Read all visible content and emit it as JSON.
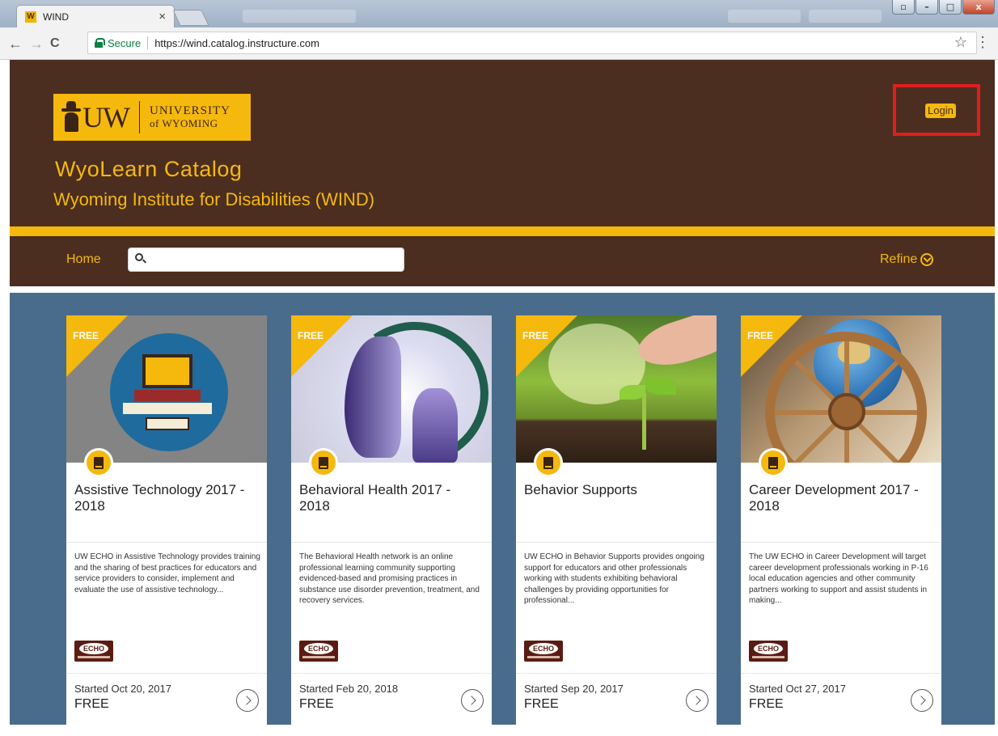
{
  "browser": {
    "tab_title": "WIND",
    "tab_favicon_label": "W",
    "tab_close": "×",
    "secure_label": "Secure",
    "url": "https://wind.catalog.instructure.com",
    "back": "←",
    "forward": "→",
    "reload": "C",
    "star": "☆",
    "menu": "⋮",
    "window_controls": [
      "▫",
      "–",
      "□",
      "x"
    ]
  },
  "header": {
    "logo_mark": "UW",
    "logo_line1": "UNIVERSITY",
    "logo_line2": "of WYOMING",
    "title": "WyoLearn Catalog",
    "subtitle": "Wyoming Institute for Disabilities (WIND)",
    "login_label": "Login"
  },
  "nav": {
    "home_label": "Home",
    "search_value": "",
    "refine_label": "Refine"
  },
  "colors": {
    "brown": "#4b2e20",
    "gold": "#f5b80d",
    "catalog_bg": "#4a6c8c",
    "highlight": "#e01e1e"
  },
  "courses": [
    {
      "ribbon": "FREE",
      "title": "Assistive Technology 2017 - 2018",
      "description": "UW ECHO in Assistive Technology provides training and the sharing of best practices for educators and service providers to consider, implement and evaluate the use of assistive technology...",
      "logo_text": "ECHO",
      "started": "Started Oct 20, 2017",
      "price": "FREE"
    },
    {
      "ribbon": "FREE",
      "title": "Behavioral Health 2017 - 2018",
      "description": "The Behavioral Health network is an online professional learning community supporting evidenced-based and promising practices in substance use disorder prevention, treatment, and recovery services.",
      "logo_text": "ECHO",
      "started": "Started Feb 20, 2018",
      "price": "FREE"
    },
    {
      "ribbon": "FREE",
      "title": "Behavior Supports",
      "description": "UW ECHO in Behavior Supports provides ongoing support for educators and other professionals working with students exhibiting behavioral challenges by providing opportunities for professional...",
      "logo_text": "ECHO",
      "started": "Started Sep 20, 2017",
      "price": "FREE"
    },
    {
      "ribbon": "FREE",
      "title": "Career Development 2017 - 2018",
      "description": "The UW ECHO in Career Development will target career development professionals working in P-16 local education agencies and other community partners working to support and assist students in making...",
      "logo_text": "ECHO",
      "started": "Started Oct 27, 2017",
      "price": "FREE"
    }
  ]
}
